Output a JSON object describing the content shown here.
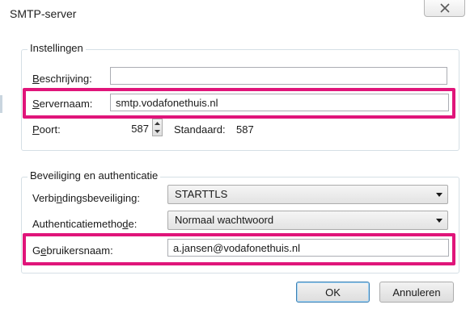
{
  "window": {
    "title": "SMTP-server"
  },
  "settings": {
    "group_title": "Instellingen",
    "description": {
      "label_first": "B",
      "label_rest": "eschrijving:",
      "value": ""
    },
    "servername": {
      "label_first": "S",
      "label_rest": "ervernaam:",
      "value": "smtp.vodafonethuis.nl"
    },
    "port": {
      "label_first": "P",
      "label_rest": "oort:",
      "value": "587",
      "default_label": "Standaard:",
      "default_value": "587"
    }
  },
  "security": {
    "group_title": "Beveiliging en authenticatie",
    "connection": {
      "label_pre": "Verbi",
      "label_u": "n",
      "label_post": "dingsbeveiliging:",
      "value": "STARTTLS"
    },
    "auth_method": {
      "label_pre": "Authenticatiemetho",
      "label_u": "d",
      "label_post": "e:",
      "value": "Normaal wachtwoord"
    },
    "username": {
      "label_pre": "G",
      "label_u": "e",
      "label_post": "bruikersnaam:",
      "value": "a.jansen@vodafonethuis.nl"
    }
  },
  "buttons": {
    "ok": "OK",
    "cancel": "Annuleren"
  },
  "colors": {
    "highlight": "#e0157a",
    "default_button_border": "#3c7fb1"
  },
  "icons": {
    "close": "close-icon",
    "spin_up": "chevron-up-icon",
    "spin_down": "chevron-down-icon",
    "dropdown": "dropdown-arrow-icon"
  }
}
